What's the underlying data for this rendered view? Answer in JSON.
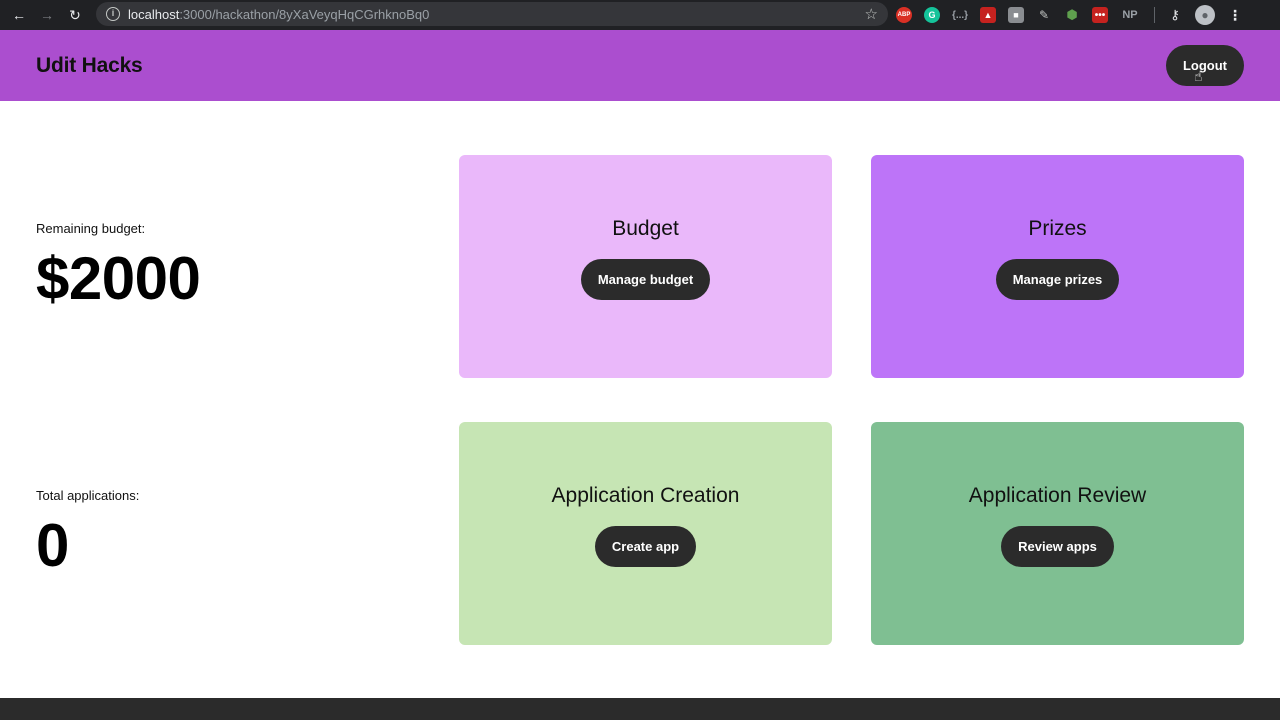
{
  "browser": {
    "url_host": "localhost",
    "url_path": ":3000/hackathon/8yXaVeyqHqCGrhknoBq0",
    "extensions": [
      {
        "name": "abp",
        "text": "ABP"
      },
      {
        "name": "grammarly",
        "text": "G"
      },
      {
        "name": "braces",
        "text": "{...}"
      },
      {
        "name": "np",
        "text": "NP"
      }
    ]
  },
  "header": {
    "brand": "Udit Hacks",
    "logout_label": "Logout",
    "color": "#ab4ecf"
  },
  "stats": [
    {
      "label": "Remaining budget:",
      "value": "$2000"
    },
    {
      "label": "Total applications:",
      "value": "0"
    }
  ],
  "cards": [
    {
      "title": "Budget",
      "button": "Manage budget",
      "color": "#eab8fa"
    },
    {
      "title": "Prizes",
      "button": "Manage prizes",
      "color": "#bd74f8"
    },
    {
      "title": "Application Creation",
      "button": "Create app",
      "color": "#c6e5b4"
    },
    {
      "title": "Application Review",
      "button": "Review apps",
      "color": "#7fbf92"
    }
  ]
}
